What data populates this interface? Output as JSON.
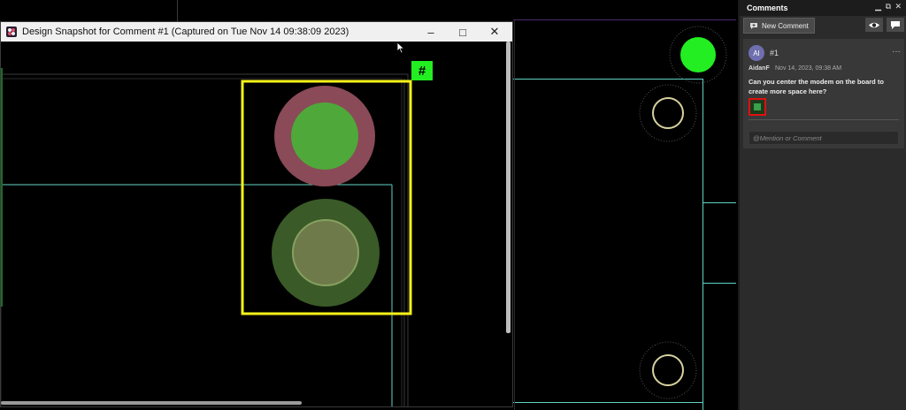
{
  "snapshot_window": {
    "title": "Design Snapshot for Comment #1 (Captured on Tue Nov 14 09:38:09 2023)",
    "minimize_glyph": "–",
    "maximize_glyph": "□",
    "close_glyph": "✕",
    "marker_label": "#"
  },
  "comments_panel": {
    "title": "Comments",
    "new_comment_label": "New Comment",
    "comment": {
      "avatar_initials": "AI",
      "number": "#1",
      "author": "AidanF",
      "timestamp": "Nov 14, 2023, 09:38 AM",
      "text": "Can you center the modem on the board to create more space here?",
      "more_glyph": "…"
    },
    "reply_placeholder": "@Mention or Comment"
  },
  "colors": {
    "trace": "#5fd3c4",
    "highlight_box": "#f7f31a",
    "marker_green": "#22ee22",
    "pad_green": "#4fa83a",
    "pad_ring_red": "#8a4a58",
    "panel_bg": "#2b2b2b",
    "thumb_border": "#e01010"
  },
  "icons": [
    "app-icon",
    "new-comment-icon",
    "eye-icon",
    "chat-icon",
    "pin-icon",
    "restore-icon",
    "close-icon"
  ]
}
